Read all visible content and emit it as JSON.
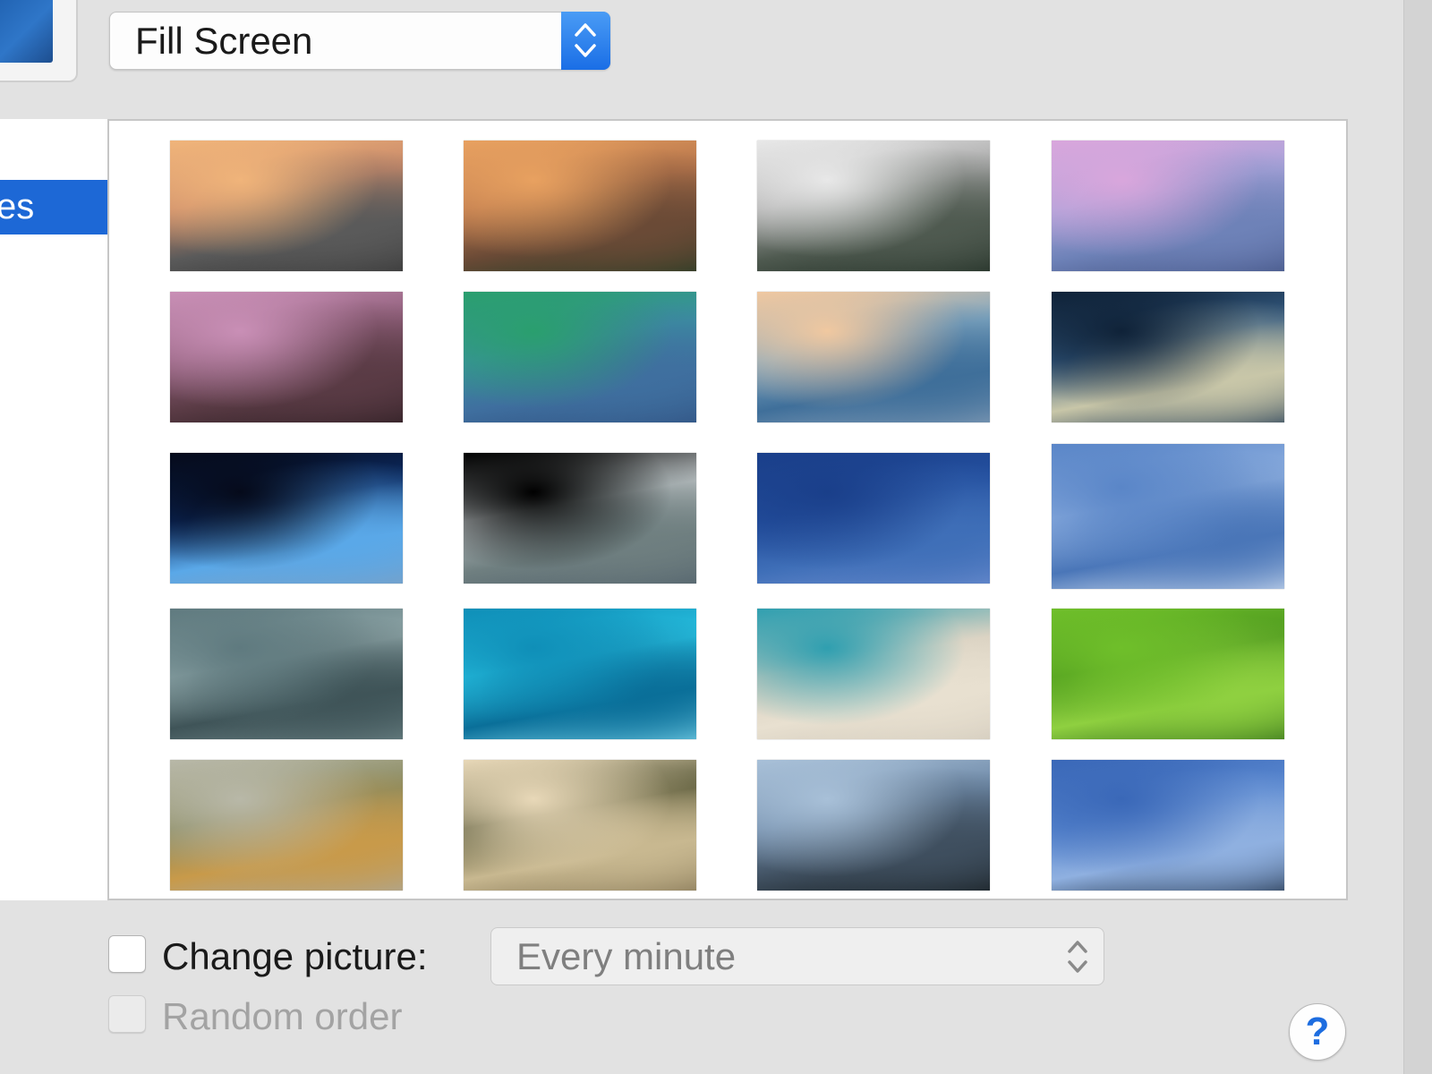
{
  "display": {
    "scaling_popup": {
      "selected": "Fill Screen"
    }
  },
  "sidebar": {
    "selected_item_label": "es"
  },
  "wallpapers": [
    {
      "name": "yosemite-half-dome-sunset",
      "colors": [
        "#f0b47a",
        "#c98a6a",
        "#5a5a5a",
        "#333333"
      ]
    },
    {
      "name": "el-capitan-sunset",
      "colors": [
        "#e8a160",
        "#b8764c",
        "#6a4a36",
        "#1f3a22"
      ]
    },
    {
      "name": "yosemite-snow-valley",
      "colors": [
        "#e8e8e8",
        "#a8a8a8",
        "#4f5a50",
        "#1c2a20"
      ]
    },
    {
      "name": "half-dome-purple-dusk",
      "colors": [
        "#d9a6dc",
        "#a9a3d9",
        "#6e82b8",
        "#3f4f7f"
      ]
    },
    {
      "name": "tenaya-lake-rocks",
      "colors": [
        "#c98fb6",
        "#8f5f7a",
        "#5a3b45",
        "#2a1c20"
      ]
    },
    {
      "name": "mavericks-wave-green",
      "colors": [
        "#2a9f6e",
        "#3b8fa0",
        "#3f6f9f",
        "#2f4f7f"
      ]
    },
    {
      "name": "wave-sunset",
      "colors": [
        "#f0c8a0",
        "#7fa6c0",
        "#3f6f9a",
        "#8aa0b8"
      ]
    },
    {
      "name": "andromeda-galaxy",
      "colors": [
        "#0f2238",
        "#33597f",
        "#c8c6a8",
        "#1a3452"
      ]
    },
    {
      "name": "earth-moon-horizon",
      "colors": [
        "#050a1a",
        "#0c2a60",
        "#5aa8e8",
        "#7f9fbf"
      ]
    },
    {
      "name": "earth-clouds-orbit",
      "colors": [
        "#000000",
        "#b8bec0",
        "#6f7f80",
        "#4f5f6a"
      ]
    },
    {
      "name": "milky-way-blue",
      "colors": [
        "#1a3f8a",
        "#24509f",
        "#3f6fb8",
        "#6f8fd0"
      ]
    },
    {
      "name": "moon-clouds-blue",
      "colors": [
        "#5a86c8",
        "#8fb0e0",
        "#4a76b8",
        "#d8e4f4"
      ]
    },
    {
      "name": "storm-clouds",
      "colors": [
        "#5f7a7f",
        "#8fa6a8",
        "#3f5458",
        "#6f8689"
      ]
    },
    {
      "name": "bahamas-aerial",
      "colors": [
        "#0f8fb8",
        "#28c0e0",
        "#0a6f99",
        "#7fd8ee"
      ]
    },
    {
      "name": "beach-shore",
      "colors": [
        "#2f9fb0",
        "#d8d0c0",
        "#e8e0d0",
        "#cfc8ba"
      ]
    },
    {
      "name": "green-rice-fields",
      "colors": [
        "#6fbf2a",
        "#4f9a1f",
        "#8fd040",
        "#2f6a18"
      ]
    },
    {
      "name": "autumn-fog-hills",
      "colors": [
        "#b8b8a8",
        "#8a8a5f",
        "#c89a4a",
        "#a8a8a0"
      ]
    },
    {
      "name": "foggy-forest-rays",
      "colors": [
        "#e8d8b8",
        "#5a5a3a",
        "#c8b890",
        "#7f7050"
      ]
    },
    {
      "name": "blue-mountain-haze",
      "colors": [
        "#a8c0d8",
        "#6f8aa8",
        "#3f4f5f",
        "#141a1c"
      ]
    },
    {
      "name": "blue-sky-horizon",
      "colors": [
        "#3a68b8",
        "#5a88d0",
        "#8fb0e0",
        "#1a2a3f"
      ]
    }
  ],
  "options": {
    "change_picture_label": "Change picture:",
    "change_interval": "Every minute",
    "random_order_label": "Random order"
  },
  "help": {
    "glyph": "?"
  }
}
